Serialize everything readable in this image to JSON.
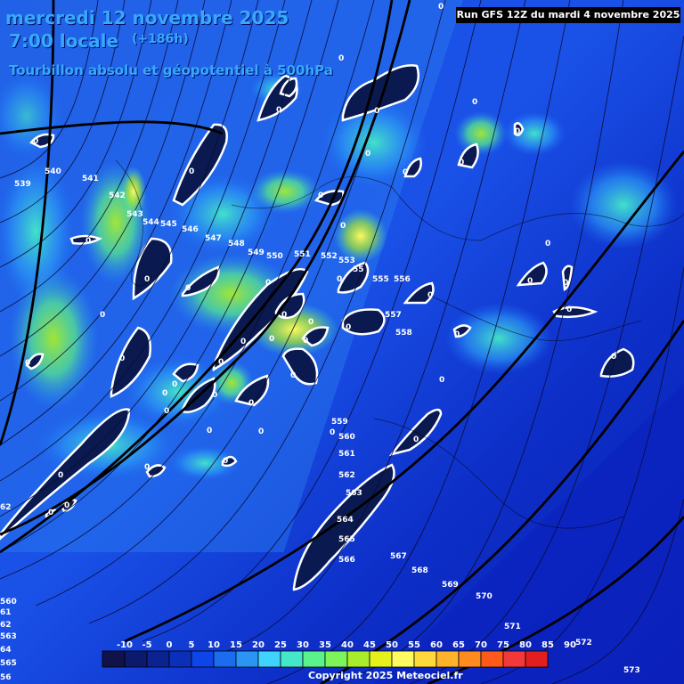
{
  "header": {
    "date": "mercredi 12 novembre 2025",
    "time": "7:00 locale",
    "lead": "(+186h)",
    "parameter": "Tourbillon absolu et géopotentiel à 500hPa",
    "run": "Run GFS 12Z du mardi 4 novembre 2025"
  },
  "footer": {
    "copyright": "Copyright 2025 Meteociel.fr"
  },
  "scale": {
    "labels": [
      "-10",
      "-5",
      "0",
      "5",
      "10",
      "15",
      "20",
      "25",
      "30",
      "35",
      "40",
      "45",
      "50",
      "55",
      "60",
      "65",
      "70",
      "75",
      "80",
      "85",
      "90"
    ],
    "colors": [
      "#10124a",
      "#0c1a6e",
      "#0a2390",
      "#0b2fb8",
      "#0d45e8",
      "#1c6cf0",
      "#2b95f5",
      "#3fd4ff",
      "#44e8c8",
      "#5af28a",
      "#7cf45a",
      "#a8ec2c",
      "#e6f01a",
      "#fffa60",
      "#ffd83a",
      "#ffb22a",
      "#ff8a20",
      "#ff5a1a",
      "#f23838",
      "#e21e1e"
    ]
  },
  "contours": {
    "labels": [
      "539",
      "540",
      "541",
      "542",
      "543",
      "544",
      "545",
      "546",
      "547",
      "548",
      "549",
      "550",
      "551",
      "552",
      "553",
      "55",
      "555",
      "556",
      "557",
      "558",
      "559",
      "560",
      "561",
      "562",
      "563",
      "564",
      "565",
      "566",
      "567",
      "568",
      "569",
      "570",
      "571",
      "572",
      "573"
    ],
    "left_edge": [
      "560",
      "61",
      "62",
      "563",
      "64",
      "565",
      "56"
    ],
    "left_mid": "62"
  },
  "vorticity_zero_label": "0"
}
